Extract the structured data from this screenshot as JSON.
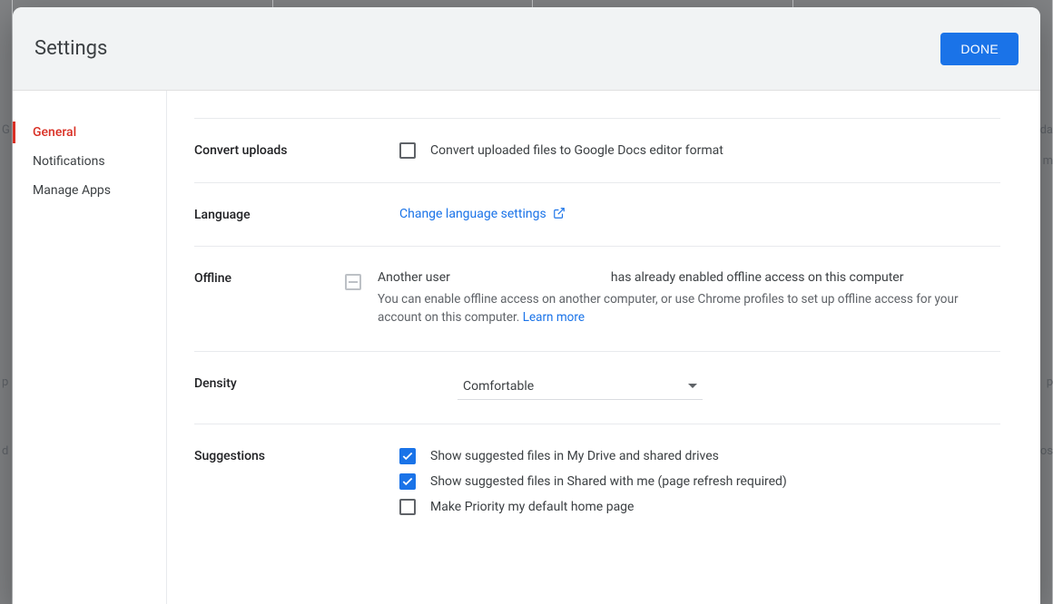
{
  "header": {
    "title": "Settings",
    "done_label": "DONE"
  },
  "sidebar": {
    "items": [
      {
        "label": "General",
        "active": true
      },
      {
        "label": "Notifications",
        "active": false
      },
      {
        "label": "Manage Apps",
        "active": false
      }
    ]
  },
  "sections": {
    "convert": {
      "label": "Convert uploads",
      "option": "Convert uploaded files to Google Docs editor format",
      "checked": false
    },
    "language": {
      "label": "Language",
      "link_text": "Change language settings"
    },
    "offline": {
      "label": "Offline",
      "state": "indeterminate",
      "line1_a": "Another user",
      "line1_b": "has already enabled offline access on this computer",
      "help": "You can enable offline access on another computer, or use Chrome profiles to set up offline access for your account on this computer.",
      "learn_more": "Learn more"
    },
    "density": {
      "label": "Density",
      "value": "Comfortable"
    },
    "suggestions": {
      "label": "Suggestions",
      "options": [
        {
          "label": "Show suggested files in My Drive and shared drives",
          "checked": true
        },
        {
          "label": "Show suggested files in Shared with me (page refresh required)",
          "checked": true
        },
        {
          "label": "Make Priority my default home page",
          "checked": false
        }
      ]
    }
  },
  "bg": {
    "hint_left_1": "G",
    "hint_right_1": "da",
    "hint_right_2": "m",
    "hint_left_2": "p",
    "hint_left_3": "d",
    "hint_right_3": "p",
    "hint_right_4": "os"
  }
}
